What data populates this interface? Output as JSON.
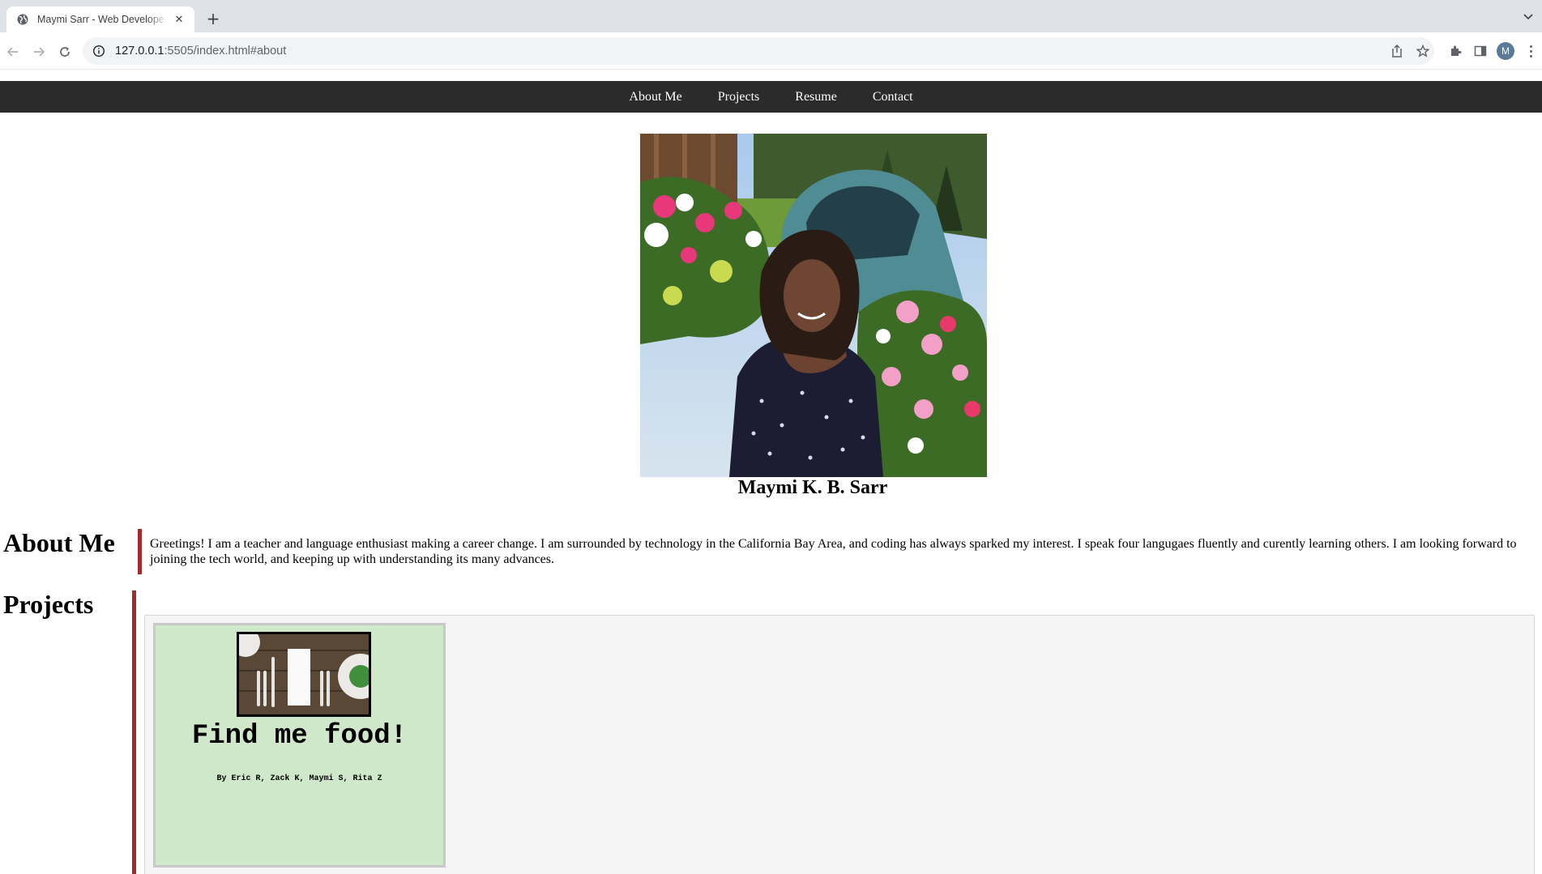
{
  "browser": {
    "tab_title": "Maymi Sarr - Web Developer Portfolio",
    "url_host": "127.0.0.1",
    "url_rest": ":5505/index.html#about",
    "avatar_initial": "M"
  },
  "nav": {
    "items": [
      "About Me",
      "Projects",
      "Resume",
      "Contact"
    ]
  },
  "profile": {
    "name": "Maymi K. B. Sarr"
  },
  "about": {
    "title": "About Me",
    "text": "Greetings! I am a teacher and language enthusiast making a career change. I am surrounded by technology in the California Bay Area, and coding has always sparked my interest. I speak four langugaes fluently and curently learning others. I am looking forward to joining the tech world, and keeping up with understanding its many advances."
  },
  "projects": {
    "title": "Projects",
    "cards": [
      {
        "title": "Find me food!",
        "authors": "By Eric R, Zack K, Maymi S, Rita Z"
      }
    ]
  },
  "colors": {
    "nav_bg": "#2b2b2b",
    "accent_bar": "#a52a2a",
    "card_bg": "#cfe8c9"
  }
}
